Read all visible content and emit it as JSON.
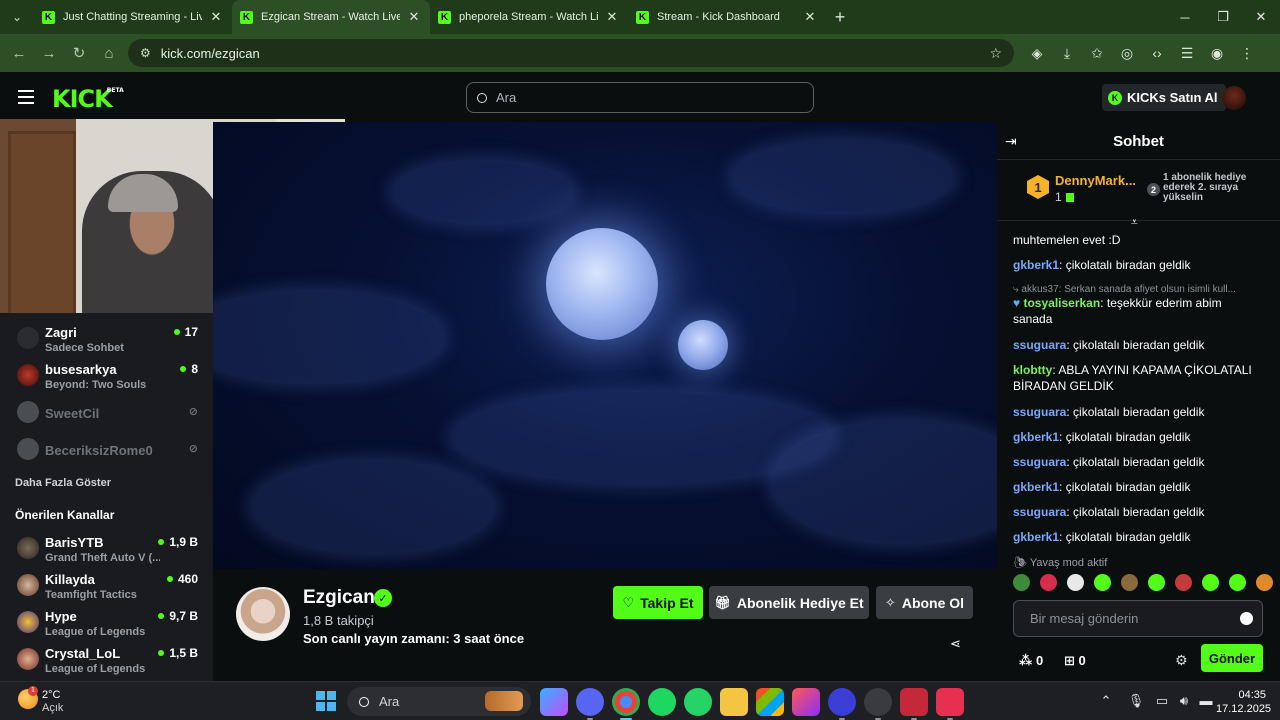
{
  "browser": {
    "tabs": [
      {
        "title": "Just Chatting Streaming - Live S",
        "active": false
      },
      {
        "title": "Ezgican Stream - Watch Live on",
        "active": true
      },
      {
        "title": "pheporela Stream - Watch Live",
        "active": false
      },
      {
        "title": "Stream - Kick Dashboard",
        "active": false
      }
    ],
    "url": "kick.com/ezgican"
  },
  "header": {
    "logo": "KICK",
    "logo_badge": "BETA",
    "search_placeholder": "Ara",
    "kicks_button": "KICKs Satın Al"
  },
  "sidebar": {
    "channels": [
      {
        "name": "Zagri",
        "subtitle": "Sadece Sohbet",
        "viewers": "17",
        "live": true
      },
      {
        "name": "busesarkya",
        "subtitle": "Beyond: Two Souls",
        "viewers": "8",
        "live": true
      },
      {
        "name": "SweetCil",
        "subtitle": "",
        "viewers": "",
        "live": false
      },
      {
        "name": "BeceriksizRome0",
        "subtitle": "",
        "viewers": "",
        "live": false
      }
    ],
    "show_more": "Daha Fazla Göster",
    "recommended_title": "Önerilen Kanallar",
    "recommended": [
      {
        "name": "BarisYTB",
        "subtitle": "Grand Theft Auto V (...",
        "viewers": "1,9 B"
      },
      {
        "name": "Killayda",
        "subtitle": "Teamfight Tactics",
        "viewers": "460"
      },
      {
        "name": "Hype",
        "subtitle": "League of Legends",
        "viewers": "9,7 B"
      },
      {
        "name": "Crystal_LoL",
        "subtitle": "League of Legends",
        "viewers": "1,5 B"
      }
    ]
  },
  "channel": {
    "name": "Ezgican",
    "followers": "1,8 B takipçi",
    "last_live": "Son canlı yayın zamanı: 3 saat önce",
    "follow_label": "Takip Et",
    "gift_label": "Abonelik Hediye Et",
    "subscribe_label": "Abone Ol"
  },
  "chat": {
    "title": "Sohbet",
    "pinned": {
      "rank": "1",
      "name": "DennyMark...",
      "count": "1",
      "rank2": "2",
      "text": "1 abonelik hediye ederek 2. sıraya yükselin"
    },
    "messages": [
      {
        "user": "",
        "text": "muhtemelen evet :D",
        "color": "#ffffff"
      },
      {
        "user": "gkberk1",
        "text": ": çikolatalı biradan geldik",
        "color": "#7aa7ff"
      },
      {
        "reply": "akkus37: Serkan sanada afiyet olsun isimli kull..."
      },
      {
        "user": "tosyaliserkan",
        "text": ": teşekkür ederim abim sanada",
        "color": "#7cf05a"
      },
      {
        "user": "ssuguara",
        "text": ": çikolatalı bieradan geldik",
        "color": "#7aa7ff"
      },
      {
        "user": "klobtty",
        "text": ": ABLA YAYINI KAPAMA ÇİKOLATALI BİRADAN GELDİK",
        "color": "#7cf05a"
      },
      {
        "user": "ssuguara",
        "text": ": çikolatalı bieradan geldik",
        "color": "#7aa7ff"
      },
      {
        "user": "gkberk1",
        "text": ": çikolatalı biradan geldik",
        "color": "#7aa7ff"
      },
      {
        "user": "ssuguara",
        "text": ": çikolatalı bieradan geldik",
        "color": "#7aa7ff"
      },
      {
        "user": "gkberk1",
        "text": ": çikolatalı biradan geldik",
        "color": "#7aa7ff"
      },
      {
        "user": "ssuguara",
        "text": ": çikolatalı bieradan geldik",
        "color": "#7aa7ff"
      },
      {
        "user": "gkberk1",
        "text": ": çikolatalı biradan geldik",
        "color": "#7aa7ff"
      }
    ],
    "slow_mode": "Yavaş mod aktif",
    "input_placeholder": "Bir mesaj gönderin",
    "points": "0",
    "gifts": "0",
    "send_label": "Gönder"
  },
  "taskbar": {
    "temperature": "2°C",
    "weather": "Açık",
    "weather_badge": "1",
    "search_placeholder": "Ara",
    "time": "04:35",
    "date": "17.12.2025"
  },
  "colors": {
    "accent": "#53fc18",
    "bg": "#0b0e0f",
    "sidebar": "#191b1f"
  }
}
